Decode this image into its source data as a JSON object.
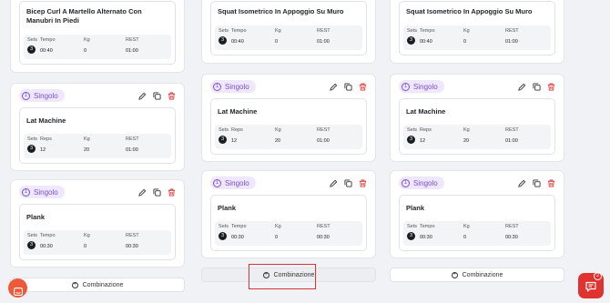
{
  "columns": [
    {
      "exercises": [
        {
          "title": "Bicep Curl A Martello Alternato Con Manubri In Piedi",
          "labels": [
            "Sets",
            "Tempo",
            "Kg",
            "REST"
          ],
          "values": [
            "3",
            "00:40",
            "0",
            "01:00"
          ]
        },
        {
          "badge": "Singolo",
          "badge_num": "1",
          "title": "Lat Machine",
          "labels": [
            "Sets",
            "Reps",
            "Kg",
            "REST"
          ],
          "values": [
            "3",
            "12",
            "20",
            "01:00"
          ]
        },
        {
          "badge": "Singolo",
          "badge_num": "1",
          "title": "Plank",
          "labels": [
            "Sets",
            "Tempo",
            "Kg",
            "REST"
          ],
          "values": [
            "3",
            "00:30",
            "0",
            "00:30"
          ]
        }
      ],
      "combo_label": "Combinazione"
    },
    {
      "exercises": [
        {
          "title": "Squat Isometrico In Appoggio Su Muro",
          "labels": [
            "Sets",
            "Tempo",
            "Kg",
            "REST"
          ],
          "values": [
            "3",
            "00:40",
            "0",
            "01:00"
          ]
        },
        {
          "badge": "Singolo",
          "badge_num": "1",
          "title": "Lat Machine",
          "labels": [
            "Sets",
            "Reps",
            "Kg",
            "REST"
          ],
          "values": [
            "3",
            "12",
            "20",
            "01:00"
          ]
        },
        {
          "badge": "Singolo",
          "badge_num": "1",
          "title": "Plank",
          "labels": [
            "Sets",
            "Tempo",
            "Kg",
            "REST"
          ],
          "values": [
            "3",
            "00:30",
            "0",
            "00:30"
          ]
        }
      ],
      "combo_label": "Combinazione"
    },
    {
      "exercises": [
        {
          "title": "Squat Isometrico In Appoggio Su Muro",
          "labels": [
            "Sets",
            "Tempo",
            "Kg",
            "REST"
          ],
          "values": [
            "3",
            "00:40",
            "0",
            "01:00"
          ]
        },
        {
          "badge": "Singolo",
          "badge_num": "1",
          "title": "Lat Machine",
          "labels": [
            "Sets",
            "Reps",
            "Kg",
            "REST"
          ],
          "values": [
            "3",
            "12",
            "20",
            "01:00"
          ]
        },
        {
          "badge": "Singolo",
          "badge_num": "1",
          "title": "Plank",
          "labels": [
            "Sets",
            "Tempo",
            "Kg",
            "REST"
          ],
          "values": [
            "3",
            "00:30",
            "0",
            "00:30"
          ]
        }
      ],
      "combo_label": "Combinazione"
    }
  ],
  "chat": {
    "notification_count": "2"
  },
  "icons": {
    "edit": "pencil-icon",
    "duplicate": "copy-icon",
    "delete": "trash-icon",
    "add": "plus-circle-icon",
    "chat": "chat-icon"
  },
  "colors": {
    "accent": "#7b4fd4",
    "delete": "#d93434",
    "chat": "#e0332f"
  }
}
